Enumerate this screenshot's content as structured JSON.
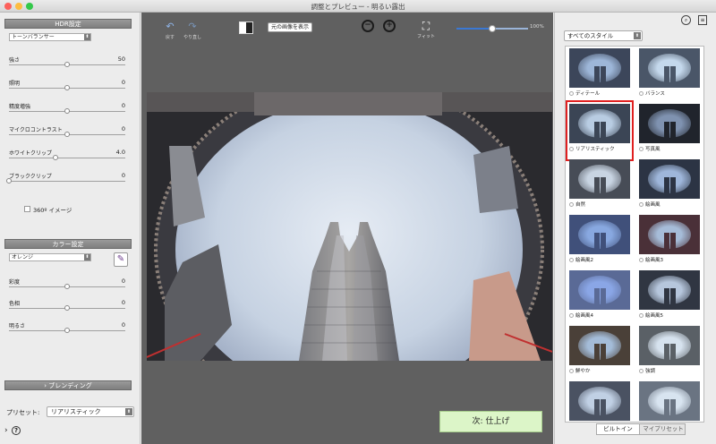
{
  "window": {
    "title": "調整とプレビュー - 明るい露出"
  },
  "colors": {
    "close": "#fc605b",
    "minimize": "#fdbc40",
    "maximize": "#34c84a",
    "accent": "#3a78d4",
    "selected_outline": "#e02020",
    "next_button": "#dcf5c8"
  },
  "left": {
    "hdr_header": "HDR設定",
    "tone_method": "トーンバランサー",
    "sliders": [
      {
        "label": "強さ",
        "value": "50",
        "level": 0.5
      },
      {
        "label": "照明",
        "value": "0",
        "level": 0.5
      },
      {
        "label": "精度増強",
        "value": "0",
        "level": 0.5
      },
      {
        "label": "マイクロコントラスト",
        "value": "0",
        "level": 0.5
      },
      {
        "label": "ホワイトクリップ",
        "value": "4.0",
        "level": 0.4
      },
      {
        "label": "ブラッククリップ",
        "value": "0",
        "level": 0.0
      }
    ],
    "image360": "360º イメージ",
    "color_header": "カラー設定",
    "color_mode": "オレンジ",
    "color_sliders": [
      {
        "label": "彩度",
        "value": "0",
        "level": 0.5
      },
      {
        "label": "色相",
        "value": "0",
        "level": 0.5
      },
      {
        "label": "明るさ",
        "value": "0",
        "level": 0.5
      }
    ],
    "blending": "ブレンディング",
    "preset_label": "プリセット:",
    "preset_value": "リアリスティック"
  },
  "toolbar": {
    "undo": "戻す",
    "redo": "やり直し",
    "show_original": "元の画像を表示",
    "fit": "フィット",
    "zoom_value": "100%",
    "zoom_level": 0.5
  },
  "next_button": "次: 仕上げ",
  "right": {
    "style_filter": "すべてのスタイル",
    "styles": [
      {
        "label": "ディテール",
        "sky": "#9db6d8",
        "tone": "#3c465a"
      },
      {
        "label": "バランス",
        "sky": "#c4d8ec",
        "tone": "#4a5668"
      },
      {
        "label": "リアリスティック",
        "sky": "#b8cce2",
        "tone": "#3b4555",
        "selected": true
      },
      {
        "label": "写真風",
        "sky": "#7f92b0",
        "tone": "#20242c"
      },
      {
        "label": "自然",
        "sky": "#c8d4e2",
        "tone": "#474c56"
      },
      {
        "label": "絵画風",
        "sky": "#9eb6da",
        "tone": "#2c3444"
      },
      {
        "label": "絵画風2",
        "sky": "#88a8e0",
        "tone": "#40507a"
      },
      {
        "label": "絵画風3",
        "sky": "#a6bcd8",
        "tone": "#4a3038"
      },
      {
        "label": "絵画風4",
        "sky": "#8aa6e6",
        "tone": "#5a6a96"
      },
      {
        "label": "絵画風5",
        "sky": "#b6c6dc",
        "tone": "#303642"
      },
      {
        "label": "鮮やか",
        "sky": "#a4bcd8",
        "tone": "#4a4038"
      },
      {
        "label": "強調",
        "sky": "#d6e2ee",
        "tone": "#5a6066"
      },
      {
        "label": "",
        "sky": "#c0d0e4",
        "tone": "#4a5262"
      },
      {
        "label": "",
        "sky": "#d8e4f0",
        "tone": "#6a7482"
      }
    ],
    "tab_builtin": "ビルトイン",
    "tab_mypreset": "マイプリセット"
  }
}
